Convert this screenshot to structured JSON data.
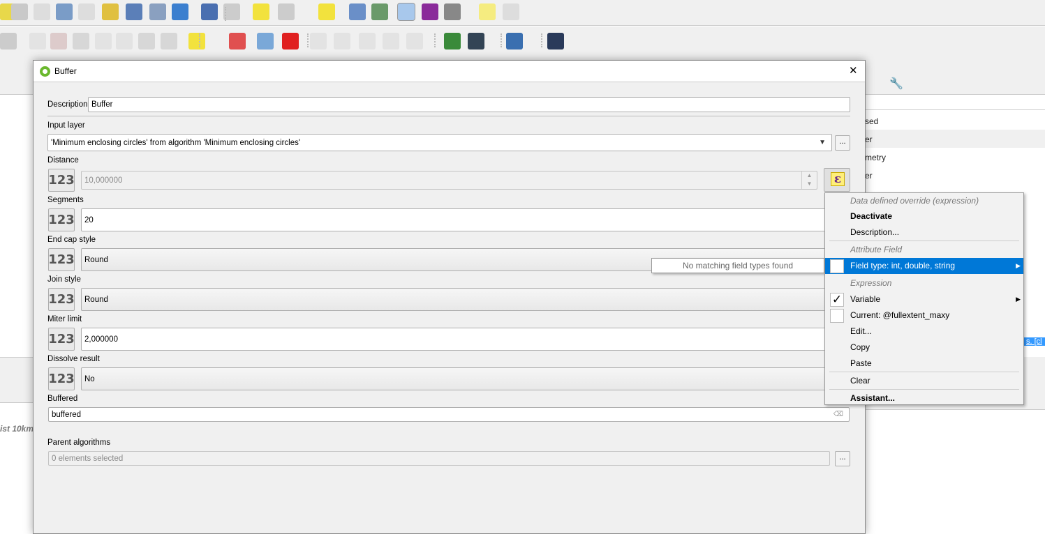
{
  "toolbar1": {
    "icons": [
      "zoom-in-icon",
      "zoom-out-icon",
      "zoom-native-icon",
      "zoom-last-icon",
      "zoom-next-icon",
      "new-bookmark-icon",
      "show-bookmarks-icon",
      "spatial-bookmark-icon",
      "refresh-icon",
      "identify-icon",
      "run-action-icon",
      "select-features-icon",
      "open-attribute-table-icon",
      "deselect-icon",
      "field-calculator-icon",
      "statistics-icon",
      "processing-toolbox-icon",
      "sigma-icon",
      "measure-icon",
      "map-tips-icon",
      "text-annotation-icon"
    ]
  },
  "toolbar2": {
    "icons": [
      "digitize-icon",
      "edit-icon",
      "delete-icon",
      "cut-icon",
      "copy-icon",
      "paste-icon",
      "undo-icon",
      "redo-icon",
      "label-icon",
      "diagram-icon",
      "pin-label-icon",
      "label-red-icon",
      "show-label-icon",
      "hide-label-icon",
      "move-label-icon",
      "rotate-label-icon",
      "change-label-icon",
      "geometry-checker-icon",
      "network-icon",
      "python-icon",
      "help-icon"
    ]
  },
  "background": {
    "list_items": [
      "sed",
      "er",
      "metry",
      "er"
    ],
    "italic_text": "ist 10km",
    "link_text": "s.  [cl"
  },
  "dialog": {
    "title": "Buffer",
    "close": "✕",
    "description_label": "Description",
    "description_value": "Buffer",
    "input_layer_label": "Input layer",
    "input_layer_value": "'Minimum enclosing circles' from algorithm 'Minimum enclosing circles'",
    "browse": "...",
    "distance_label": "Distance",
    "distance_value": "10,000000",
    "segments_label": "Segments",
    "segments_value": "20",
    "end_cap_label": "End cap style",
    "end_cap_value": "Round",
    "join_label": "Join style",
    "join_value": "Round",
    "miter_label": "Miter limit",
    "miter_value": "2,000000",
    "dissolve_label": "Dissolve result",
    "dissolve_value": "No",
    "buffered_label": "Buffered",
    "buffered_value": "buffered",
    "parent_label": "Parent algorithms",
    "parent_value": "0 elements selected",
    "param_button": "123",
    "expr_glyph": "ε"
  },
  "menu": {
    "header": "Data defined override (expression)",
    "deactivate": "Deactivate",
    "description": "Description...",
    "attribute_header": "Attribute Field",
    "field_type": "Field type: int, double, string",
    "expression_header": "Expression",
    "variable": "Variable",
    "current": "Current: @fullextent_maxy",
    "edit": "Edit...",
    "copy": "Copy",
    "paste": "Paste",
    "clear": "Clear",
    "assistant": "Assistant...",
    "check": "✓"
  },
  "submenu": {
    "text": "No matching field types found"
  },
  "colors": {
    "highlight": "#0078d7",
    "dialog_bg": "#f0f0f0"
  }
}
